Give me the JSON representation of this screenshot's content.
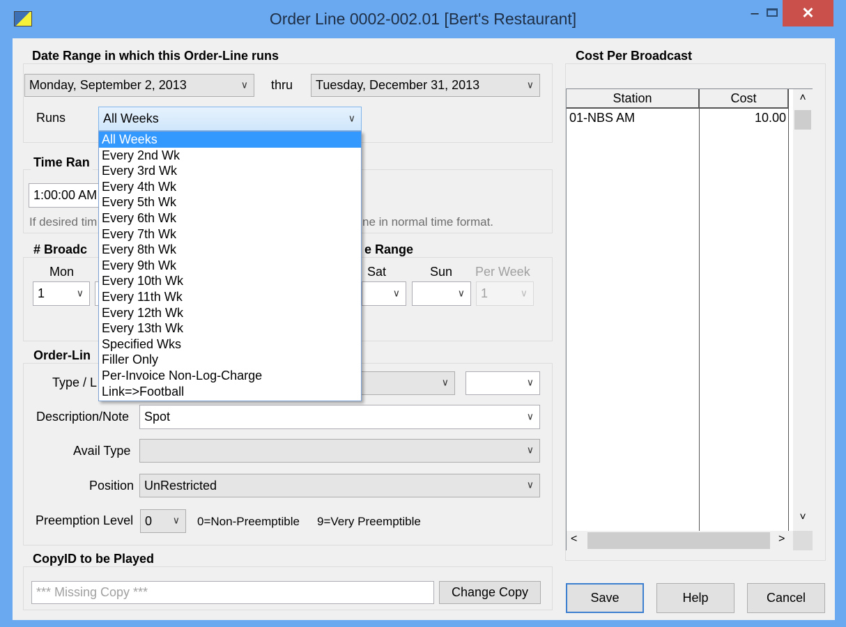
{
  "window": {
    "title": "Order Line 0002-002.01  [Bert's Restaurant]",
    "minimize": "–",
    "close": "✕"
  },
  "date_range": {
    "title": "Date Range in which this Order-Line runs",
    "start": "Monday, September 2, 2013",
    "thru_label": "thru",
    "end": "Tuesday, December 31, 2013",
    "runs_label": "Runs",
    "runs_value": "All Weeks",
    "runs_options": [
      "All Weeks",
      "Every 2nd Wk",
      "Every 3rd Wk",
      "Every 4th Wk",
      "Every 5th Wk",
      "Every 6th Wk",
      "Every 7th Wk",
      "Every 8th Wk",
      "Every 9th Wk",
      "Every 10th Wk",
      "Every 11th Wk",
      "Every 12th Wk",
      "Every 13th Wk",
      "Specified Wks",
      "Filler Only",
      "Per-Invoice Non-Log-Charge",
      "Link=>Football"
    ]
  },
  "time_range": {
    "title_visible": "Time Ran",
    "time_value": "1:00:00 AM",
    "hint_left": "If desired tim",
    "hint_right": "ne in normal time format."
  },
  "broadcasts": {
    "title_left": "# Broadc",
    "title_right": "e Range",
    "mon_label": "Mon",
    "mon_value": "1",
    "sat_label": "Sat",
    "sat_value": "",
    "sun_label": "Sun",
    "sun_value": "",
    "perweek_label": "Per Week",
    "perweek_value": "1"
  },
  "order_line": {
    "title_visible": "Order-Lin",
    "type_label_visible": "Type / L",
    "type_value": "",
    "type2_value": "",
    "desc_label": "Description/Note",
    "desc_value": "Spot",
    "avail_label": "Avail Type",
    "avail_value": "",
    "position_label": "Position",
    "position_value": "UnRestricted",
    "preempt_label": "Preemption Level",
    "preempt_value": "0",
    "preempt_hint_low": "0=Non-Preemptible",
    "preempt_hint_high": "9=Very Preemptible"
  },
  "copy": {
    "title": "CopyID to be Played",
    "placeholder": "*** Missing Copy ***",
    "change_button": "Change Copy"
  },
  "cost": {
    "title": "Cost Per Broadcast",
    "columns": [
      "Station",
      "Cost"
    ],
    "rows": [
      {
        "station": "01-NBS AM",
        "cost": "10.00"
      }
    ]
  },
  "buttons": {
    "save": "Save",
    "help": "Help",
    "cancel": "Cancel"
  },
  "icons": {
    "dropdown": "chevron-down-icon",
    "scroll_up": "˄",
    "scroll_down": "˅",
    "scroll_left": "<",
    "scroll_right": ">",
    "chev": "∨"
  }
}
